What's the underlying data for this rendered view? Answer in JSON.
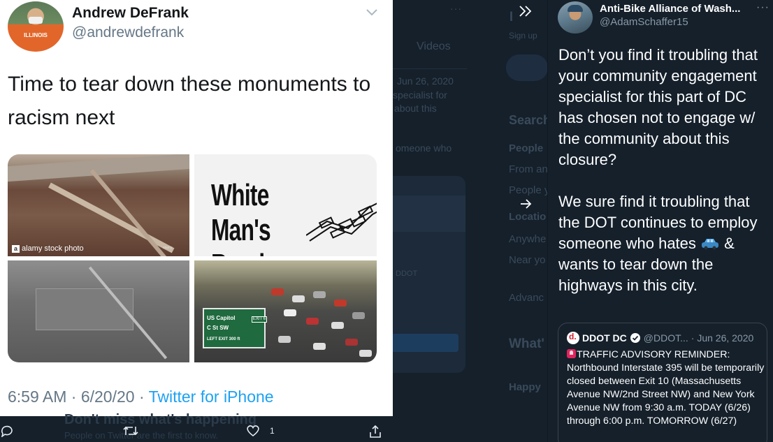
{
  "background": {
    "videos_label": "Videos",
    "date_fragment": "Jun 26, 2020",
    "specialist_fragment": "specialist for",
    "about_fragment": "about this",
    "someone_fragment": "omeone who",
    "search_fragment": "Search",
    "people_fragment": "People",
    "from_fragment": "From an",
    "people_you_fragment": "People y",
    "location_fragment": "Locatio",
    "anywhere_fragment": "Anywhe",
    "near_fragment": "Near yo",
    "advanced_fragment": "Advanc",
    "whats_fragment": "What'",
    "happy_fragment": "Happy",
    "signup_fragment": "Sign up",
    "ddot_fragment": "DDOT",
    "dont_miss": "Don't miss what's happening",
    "people_first": "People on Twitter are the first to know."
  },
  "left_tweet": {
    "author_name": "Andrew DeFrank",
    "author_handle": "@andrewdefrank",
    "avatar_shirt_text": "ILLINOIS",
    "text": "Time to tear down these monuments to racism next",
    "media": {
      "photo1_watermark": "alamy stock photo",
      "photo1_watermark_mark": "a",
      "photo1_small": "alamy",
      "photo2_poster": "White Man's Road...",
      "photo4_sign_line1": "US Capitol",
      "photo4_sign_line2": "C St SW",
      "photo4_sign_line3": "LEFT EXIT 300 ft",
      "photo4_exit": "EXIT 6"
    },
    "timestamp": "6:59 AM · 6/20/20 · ",
    "source": "Twitter for iPhone"
  },
  "action_bar": {
    "like_count": "1"
  },
  "right_tweet": {
    "author_name": "Anti-Bike Alliance of Wash...",
    "author_handle": "@AdamSchaffer15",
    "more": "···",
    "text_part1": "Don’t you find it troubling that your community engagement specialist for this part of DC has chosen not to engage w/ the community about this closure?\n\nWe sure find it troubling that the DOT continues to employ someone who hates ",
    "text_part2": " & wants to tear down the highways in this city.",
    "quote": {
      "name": "DDOT DC",
      "handle": "@DDOT...",
      "date": "· Jun 26, 2020",
      "body": "TRAFFIC ADVISORY REMINDER: Northbound Interstate 395 will be temporarily closed between Exit 10 (Massachusetts Avenue NW/2nd Street NW) and New York Avenue NW from 9:30 a.m. TODAY (6/26) through 6:00 p.m. TOMORROW (6/27)"
    }
  },
  "icons": {
    "collapse": "double-chevron-right-icon",
    "arrow": "arrow-right-icon",
    "reply": "reply-icon",
    "retweet": "retweet-icon",
    "like": "heart-icon",
    "share": "share-icon",
    "verified": "verified-badge-icon"
  },
  "colors": {
    "twitter_blue": "#1da1f2",
    "dark_bg": "#15202b",
    "muted_text": "#657786",
    "ddot_red": "#d31f2b"
  }
}
